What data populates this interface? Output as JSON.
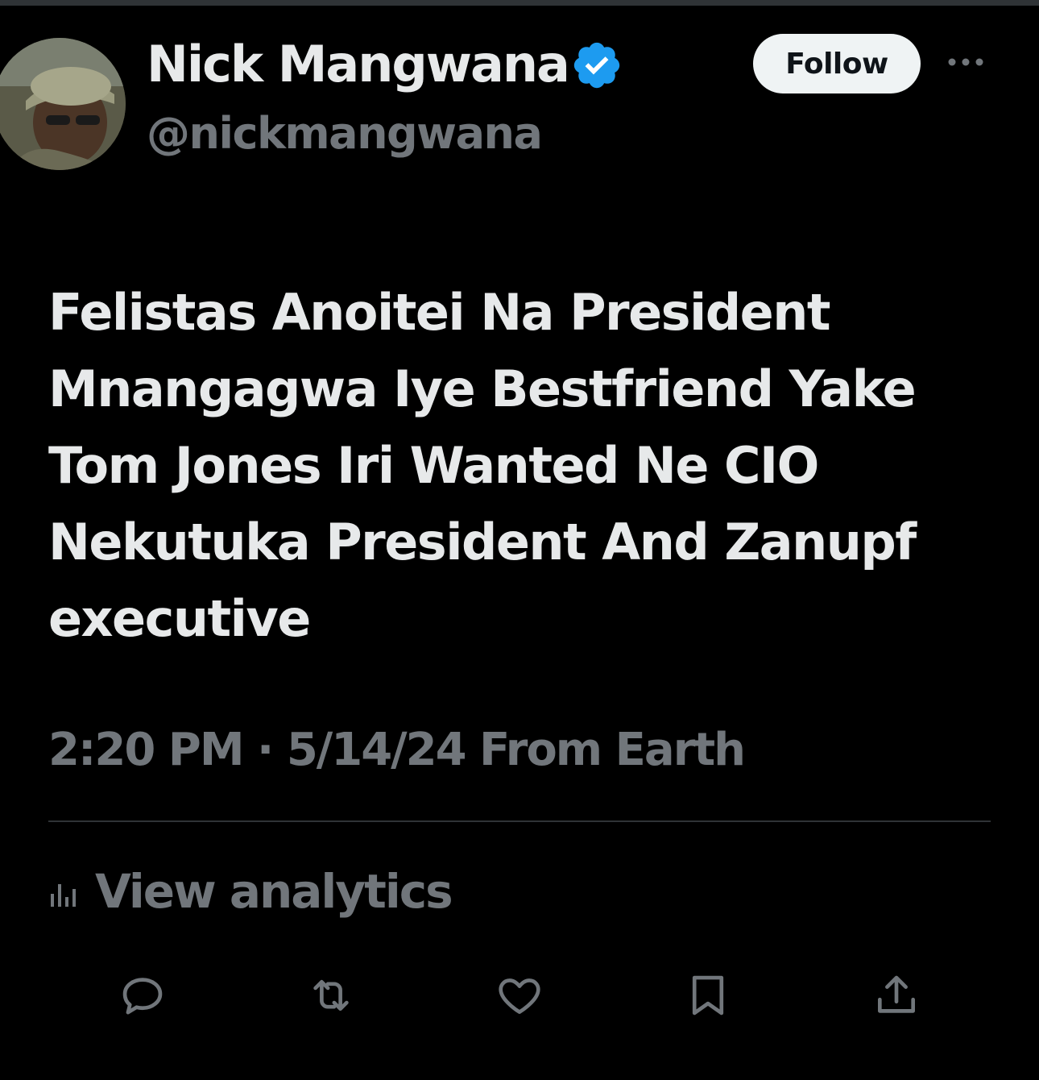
{
  "author": {
    "display_name": "Nick Mangwana",
    "handle": "@nickmangwana",
    "verified_color": "#1d9bf0"
  },
  "header": {
    "follow_label": "Follow",
    "more_icon": "more-horizontal-icon"
  },
  "tweet": {
    "lines": [
      "Felistas Anoitei Na President",
      "Mnangagwa Iye Bestfriend Yake",
      "Tom Jones Iri Wanted Ne CIO",
      "Nekutuka President And Zanupf",
      "executive"
    ],
    "meta": "2:20 PM · 5/14/24 From Earth"
  },
  "analytics": {
    "label": "View analytics",
    "icon": "analytics-icon"
  },
  "actions": {
    "reply_icon": "reply-icon",
    "repost_icon": "repost-icon",
    "like_icon": "like-icon",
    "bookmark_icon": "bookmark-icon",
    "share_icon": "share-icon"
  },
  "colors": {
    "background": "#000000",
    "primary_text": "#e7e9ea",
    "secondary_text": "#71767b",
    "divider": "#2f3336"
  }
}
